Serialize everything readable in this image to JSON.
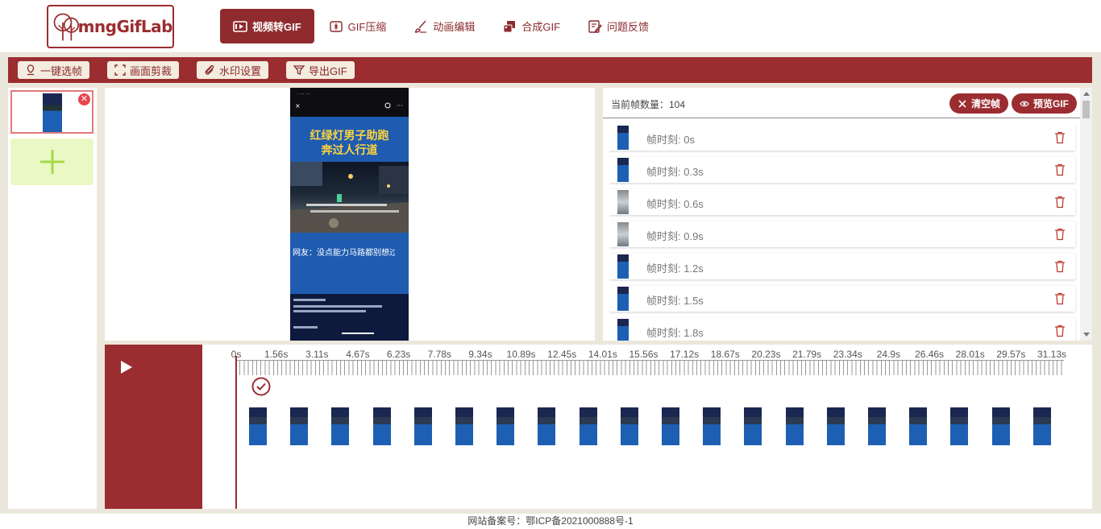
{
  "header": {
    "logo_text": "mngGifLab",
    "nav": [
      {
        "label": "视频转GIF",
        "icon": "film-icon",
        "active": true
      },
      {
        "label": "GIF压缩",
        "icon": "compress-icon",
        "active": false
      },
      {
        "label": "动画编辑",
        "icon": "brush-icon",
        "active": false
      },
      {
        "label": "合成GIF",
        "icon": "merge-icon",
        "active": false
      },
      {
        "label": "问题反馈",
        "icon": "feedback-icon",
        "active": false
      }
    ]
  },
  "toolbar": {
    "buttons": [
      {
        "label": "一键选帧",
        "icon": "pin-icon"
      },
      {
        "label": "画面剪裁",
        "icon": "crop-icon"
      },
      {
        "label": "水印设置",
        "icon": "clip-icon"
      },
      {
        "label": "导出GIF",
        "icon": "filter-icon"
      }
    ]
  },
  "video": {
    "title_line1": "红绿灯男子助跑",
    "title_line2": "奔过人行道",
    "caption": "网友：没点能力马路都别想过"
  },
  "frames": {
    "count_label": "当前帧数量：104",
    "clear_label": "清空帧",
    "preview_label": "预览GIF",
    "rows": [
      {
        "label": "帧时刻: 0s"
      },
      {
        "label": "帧时刻: 0.3s"
      },
      {
        "label": "帧时刻: 0.6s"
      },
      {
        "label": "帧时刻: 0.9s"
      },
      {
        "label": "帧时刻: 1.2s"
      },
      {
        "label": "帧时刻: 1.5s"
      },
      {
        "label": "帧时刻: 1.8s"
      }
    ]
  },
  "timeline": {
    "ticks": [
      "0s",
      "1.56s",
      "3.11s",
      "4.67s",
      "6.23s",
      "7.78s",
      "9.34s",
      "10.89s",
      "12.45s",
      "14.01s",
      "15.56s",
      "17.12s",
      "18.67s",
      "20.23s",
      "21.79s",
      "23.34s",
      "24.9s",
      "26.46s",
      "28.01s",
      "29.57s",
      "31.13s"
    ],
    "thumb_count": 20
  },
  "footer": {
    "text": "网站备案号：鄂ICP备2021000888号-1"
  }
}
